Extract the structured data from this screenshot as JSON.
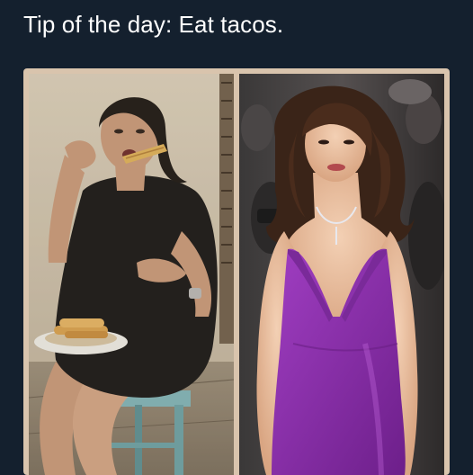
{
  "meme": {
    "caption": "Tip of the day: Eat tacos."
  },
  "colors": {
    "background": "#14202e",
    "frame": "#d9c4ad",
    "dress": "#8a2fa8",
    "black_dress": "#151516",
    "stool": "#7fb6bb"
  }
}
